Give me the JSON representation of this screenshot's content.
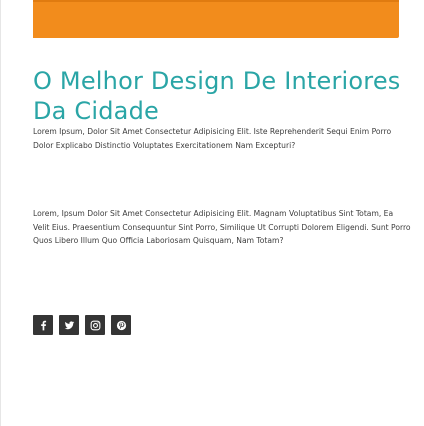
{
  "colors": {
    "banner": "#f28c1c",
    "title": "#2aa5a6",
    "body_text": "#3c3c3c",
    "social_bg": "#353535",
    "social_icon": "#ffffff"
  },
  "section": {
    "title": "O Melhor Design De Interiores Da Cidade",
    "paragraph_1": "Lorem Ipsum, Dolor Sit Amet Consectetur Adipisicing Elit. Iste Reprehenderit Sequi Enim Porro Dolor Explicabo Distinctio Voluptates Exercitationem Nam Excepturi?",
    "paragraph_2": "Lorem, Ipsum Dolor Sit Amet Consectetur Adipisicing Elit. Magnam Voluptatibus Sint Totam, Ea Velit Eius. Praesentium Consequuntur Sint Porro, Similique Ut Corrupti Dolorem Eligendi. Sunt Porro Quos Libero Illum Quo Officia Laboriosam Quisquam, Nam Totam?"
  },
  "social": [
    {
      "icon": "facebook-icon"
    },
    {
      "icon": "twitter-icon"
    },
    {
      "icon": "instagram-icon"
    },
    {
      "icon": "pinterest-icon"
    }
  ]
}
